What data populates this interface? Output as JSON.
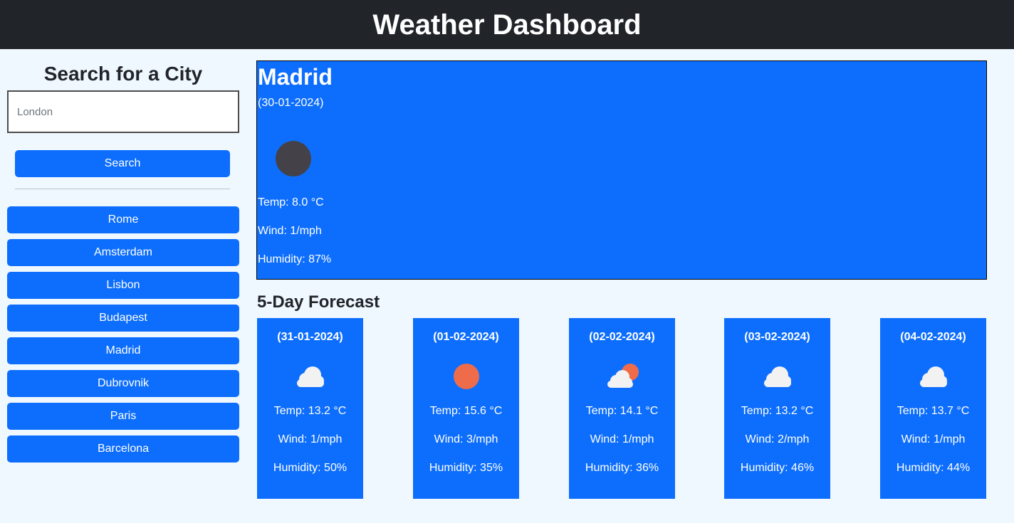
{
  "header": {
    "title": "Weather Dashboard"
  },
  "sidebar": {
    "title": "Search for a City",
    "search_placeholder": "London",
    "search_label": "Search",
    "cities": [
      "Rome",
      "Amsterdam",
      "Lisbon",
      "Budapest",
      "Madrid",
      "Dubrovnik",
      "Paris",
      "Barcelona"
    ]
  },
  "current": {
    "city": "Madrid",
    "date": "(30-01-2024)",
    "icon": "moon-icon",
    "temp": "Temp: 8.0 °C",
    "wind": "Wind: 1/mph",
    "humidity": "Humidity: 87%"
  },
  "forecast": {
    "title": "5-Day Forecast",
    "days": [
      {
        "date": "(31-01-2024)",
        "icon": "cloud-icon",
        "temp": "Temp: 13.2 °C",
        "wind": "Wind: 1/mph",
        "humidity": "Humidity: 50%"
      },
      {
        "date": "(01-02-2024)",
        "icon": "sun-icon",
        "temp": "Temp: 15.6 °C",
        "wind": "Wind: 3/mph",
        "humidity": "Humidity: 35%"
      },
      {
        "date": "(02-02-2024)",
        "icon": "partly-cloudy-icon",
        "temp": "Temp: 14.1 °C",
        "wind": "Wind: 1/mph",
        "humidity": "Humidity: 36%"
      },
      {
        "date": "(03-02-2024)",
        "icon": "cloud-icon",
        "temp": "Temp: 13.2 °C",
        "wind": "Wind: 2/mph",
        "humidity": "Humidity: 46%"
      },
      {
        "date": "(04-02-2024)",
        "icon": "cloud-icon",
        "temp": "Temp: 13.7 °C",
        "wind": "Wind: 1/mph",
        "humidity": "Humidity: 44%"
      }
    ]
  },
  "colors": {
    "accent": "#0d6efd",
    "header_bg": "#212529",
    "page_bg": "#f0f8ff",
    "sun": "#ef6c4a",
    "moon": "#444248",
    "cloud": "#f2f2f2"
  }
}
